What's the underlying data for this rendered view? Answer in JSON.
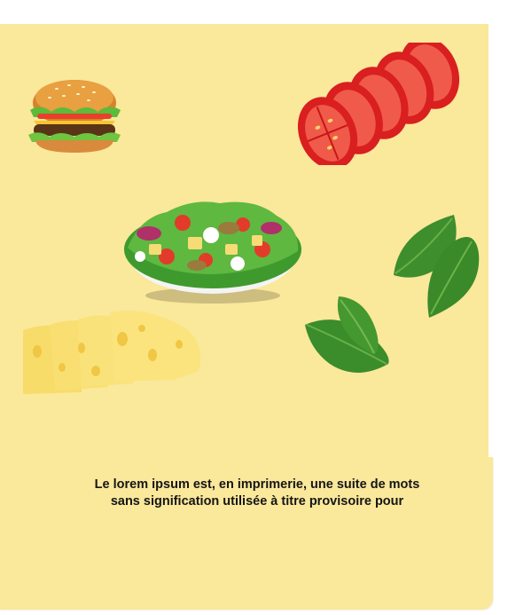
{
  "caption": "Le lorem ipsum est, en imprimerie, une suite de mots sans signification utilisée à titre provisoire pour",
  "images": [
    "burger",
    "tomato-slices",
    "salad-bowl",
    "spinach-leaves",
    "spinach-leaf",
    "cheese-slices"
  ],
  "colors": {
    "background": "#fae89b",
    "text": "#151515"
  }
}
